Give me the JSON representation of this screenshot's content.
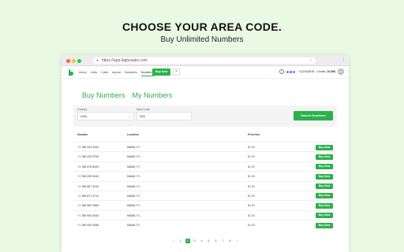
{
  "hero": {
    "title": "CHOOSE YOUR AREA CODE.",
    "subtitle": "Buy Unlimited Numbers"
  },
  "browser": {
    "url": "https://app.bigtysales.com",
    "lock_icon": "lock-icon"
  },
  "nav": {
    "links": [
      "Inbox",
      "Lists",
      "Calls",
      "Import",
      "Booklets",
      "Numbers"
    ],
    "active": "Numbers",
    "buy_now": "Buy Now",
    "plus": "+",
    "phone": "+1(234)5678",
    "credits_label": "Credits:",
    "credits_value": "10,568",
    "avatar": "AS"
  },
  "tabs": {
    "buy": "Buy Numbers",
    "mine": "My Numbers"
  },
  "filter": {
    "country_label": "Country",
    "country_value": "USA",
    "area_label": "Area Code",
    "area_value": "305",
    "search_button": "Search Numbers"
  },
  "table": {
    "headers": [
      "Number",
      "Location",
      "Price/mo",
      ""
    ],
    "rows": [
      {
        "number": "+1 786 433 3344",
        "location": "MIAMI, FL",
        "price": "$1.00",
        "action": "Buy Now"
      },
      {
        "number": "+1 786 433 9794",
        "location": "MIAMI, FL",
        "price": "$1.00",
        "action": "Buy Now"
      },
      {
        "number": "+1 786 578 8209",
        "location": "MIAMI, FL",
        "price": "$1.00",
        "action": "Buy Now"
      },
      {
        "number": "+1 786 299 0042",
        "location": "MIAMI, FL",
        "price": "$1.00",
        "action": "Buy Now"
      },
      {
        "number": "+1 786 587 3316",
        "location": "MIAMI, FL",
        "price": "$1.00",
        "action": "Buy Now"
      },
      {
        "number": "+1 786 871 3714",
        "location": "MIAMI, FL",
        "price": "$1.00",
        "action": "Buy Now"
      },
      {
        "number": "+1 786 960 3589",
        "location": "MIAMI, FL",
        "price": "$1.00",
        "action": "Buy Now"
      },
      {
        "number": "+1 786 900 0040",
        "location": "MIAMI, FL",
        "price": "$1.00",
        "action": "Buy Now"
      },
      {
        "number": "+1 786 900 0058",
        "location": "MIAMI, FL",
        "price": "$1.00",
        "action": "Buy Now"
      }
    ]
  },
  "pager": {
    "prev": "‹",
    "pages": [
      "1",
      "2",
      "3",
      "4",
      "5",
      "6",
      "7",
      "8"
    ],
    "current": "2",
    "next": "›"
  },
  "colors": {
    "accent": "#2bb14b",
    "background": "#e9f9e3"
  }
}
